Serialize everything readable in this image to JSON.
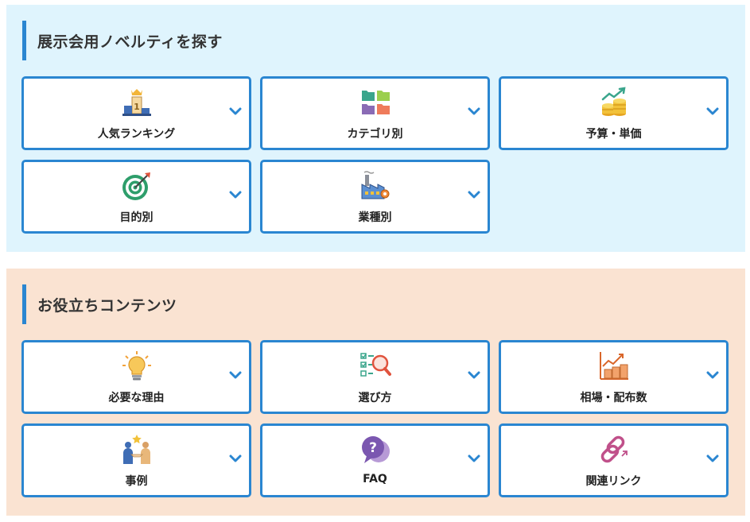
{
  "sections": [
    {
      "heading": "展示会用ノベルティを探す",
      "cards": [
        {
          "label": "人気ランキング",
          "icon": "ranking-podium-icon"
        },
        {
          "label": "カテゴリ別",
          "icon": "category-folders-icon"
        },
        {
          "label": "予算・単価",
          "icon": "budget-coins-icon"
        },
        {
          "label": "目的別",
          "icon": "target-dart-icon"
        },
        {
          "label": "業種別",
          "icon": "factory-icon"
        }
      ]
    },
    {
      "heading": "お役立ちコンテンツ",
      "cards": [
        {
          "label": "必要な理由",
          "icon": "lightbulb-icon"
        },
        {
          "label": "選び方",
          "icon": "checklist-magnifier-icon"
        },
        {
          "label": "相場・配布数",
          "icon": "price-chart-icon"
        },
        {
          "label": "事例",
          "icon": "handshake-people-icon"
        },
        {
          "label": "FAQ",
          "icon": "faq-bubble-icon"
        },
        {
          "label": "関連リンク",
          "icon": "link-chain-icon"
        }
      ]
    }
  ],
  "colors": {
    "accent": "#2a86d1",
    "explore_bg": "#dff4fd",
    "useful_bg": "#fae3d2"
  }
}
